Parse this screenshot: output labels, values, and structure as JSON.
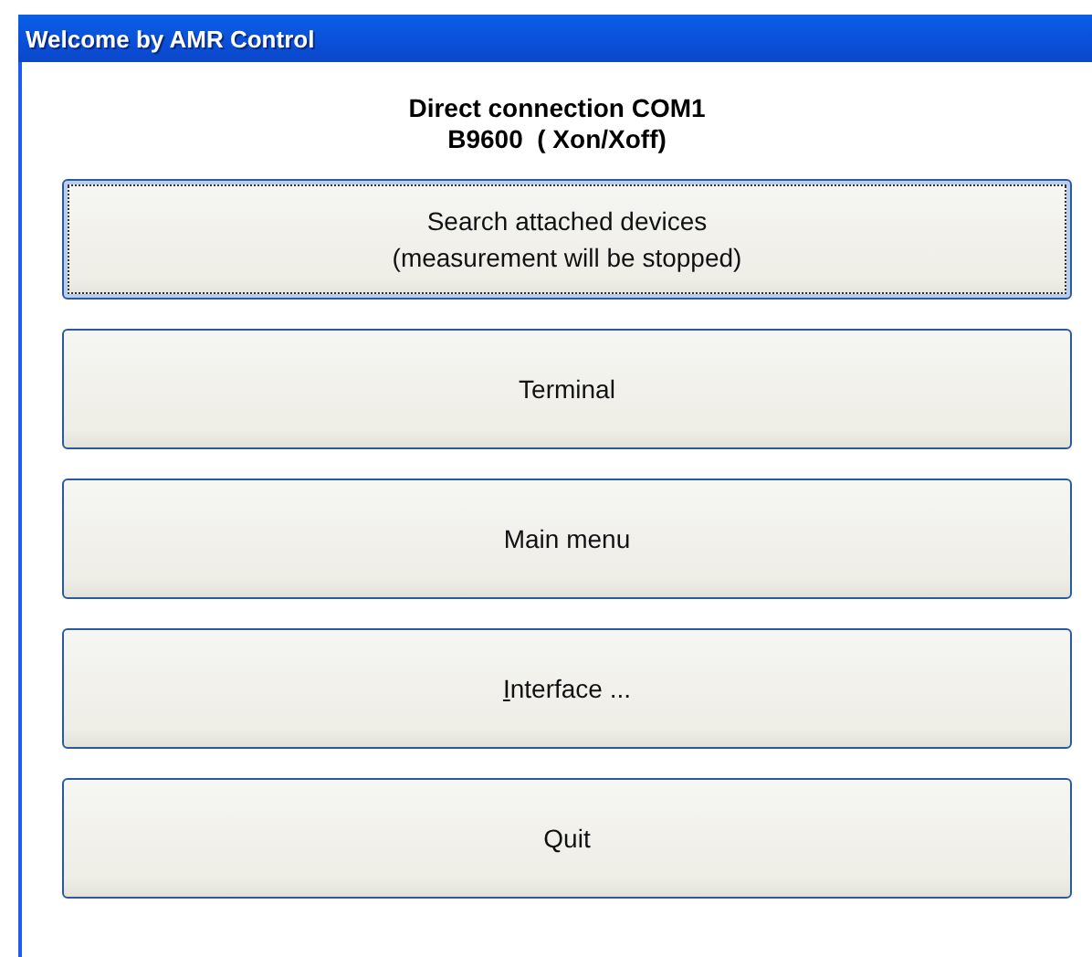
{
  "window": {
    "title": "Welcome by AMR Control"
  },
  "heading": [
    "Direct connection COM1",
    "B9600  ( Xon/Xoff)"
  ],
  "buttons": [
    {
      "label": "Search attached devices\n(measurement will be stopped)",
      "focused": true,
      "mnemonic": false
    },
    {
      "label": "Terminal",
      "focused": false,
      "mnemonic": false
    },
    {
      "label": "Main menu",
      "focused": false,
      "mnemonic": false
    },
    {
      "label": "Interface ...",
      "focused": false,
      "mnemonic": true
    },
    {
      "label": "Quit",
      "focused": false,
      "mnemonic": false
    }
  ]
}
